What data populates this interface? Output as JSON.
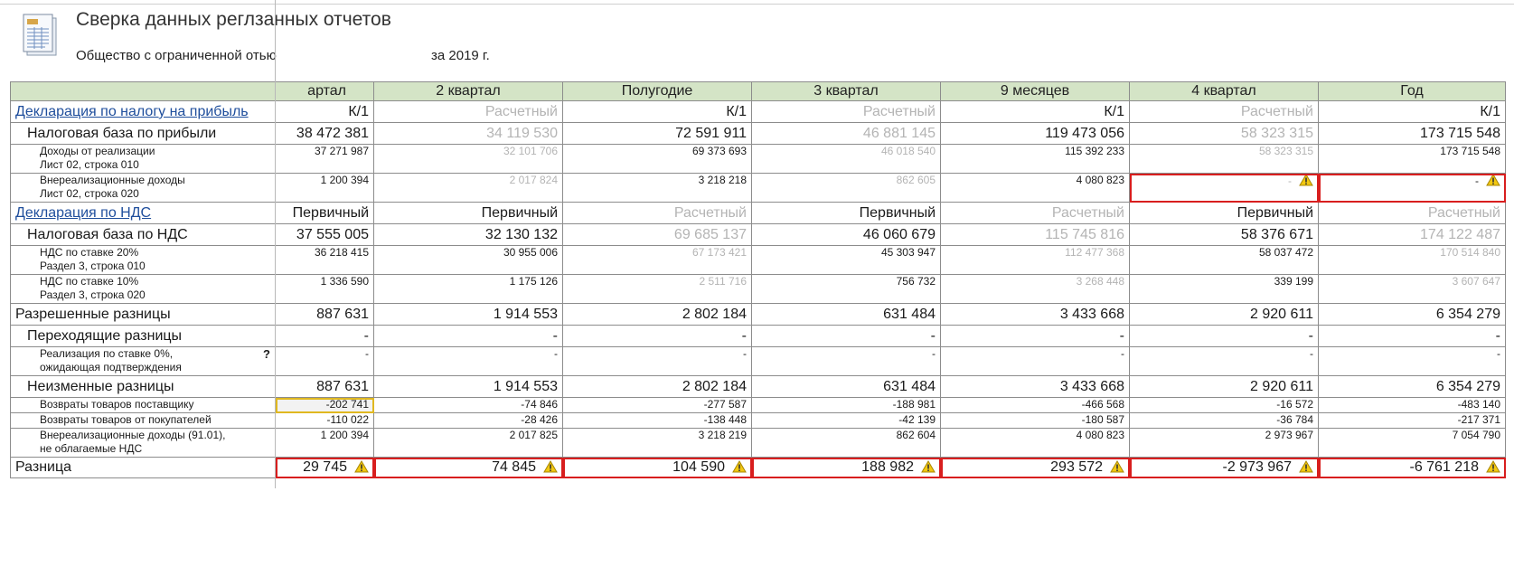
{
  "header": {
    "title": "Сверка данных реглзанных отчетов",
    "org": "Общество с ограниченной отью",
    "period": "за 2019 г."
  },
  "columns": [
    "артал",
    "2 квартал",
    "Полугодие",
    "3 квартал",
    "9 месяцев",
    "4 квартал",
    "Год"
  ],
  "sections": {
    "profit": {
      "label": "Декларация по налогу на прибыль",
      "statuses": [
        "К/1",
        "Расчетный",
        "К/1",
        "Расчетный",
        "К/1",
        "Расчетный",
        "К/1"
      ]
    },
    "vat": {
      "label": "Декларация по НДС",
      "statuses": [
        "Первичный",
        "Первичный",
        "Расчетный",
        "Первичный",
        "Расчетный",
        "Первичный",
        "Расчетный"
      ]
    }
  },
  "rows": {
    "profit_base": {
      "label": "Налоговая база по прибыли",
      "values": [
        "38 472 381",
        "34 119 530",
        "72 591 911",
        "46 881 145",
        "119 473 056",
        "58 323 315",
        "173 715 548"
      ]
    },
    "sales_income": {
      "label1": "Доходы от реализации",
      "label2": "Лист 02, строка 010",
      "values": [
        "37 271 987",
        "32 101 706",
        "69 373 693",
        "46 018 540",
        "115 392 233",
        "58 323 315",
        "173 715 548"
      ]
    },
    "nonop_income": {
      "label1": "Внереализационные доходы",
      "label2": "Лист 02, строка 020",
      "values": [
        "1 200 394",
        "2 017 824",
        "3 218 218",
        "862 605",
        "4 080 823",
        "-",
        "-"
      ]
    },
    "vat_base": {
      "label": "Налоговая база по НДС",
      "values": [
        "37 555 005",
        "32 130 132",
        "69 685 137",
        "46 060 679",
        "115 745 816",
        "58 376 671",
        "174 122 487"
      ]
    },
    "vat20": {
      "label1": "НДС по ставке 20%",
      "label2": "Раздел 3, строка 010",
      "values": [
        "36 218 415",
        "30 955 006",
        "67 173 421",
        "45 303 947",
        "112 477 368",
        "58 037 472",
        "170 514 840"
      ]
    },
    "vat10": {
      "label1": "НДС по ставке 10%",
      "label2": "Раздел 3, строка 020",
      "values": [
        "1 336 590",
        "1 175 126",
        "2 511 716",
        "756 732",
        "3 268 448",
        "339 199",
        "3 607 647"
      ]
    },
    "allowed": {
      "label": "Разрешенные разницы",
      "values": [
        "887 631",
        "1 914 553",
        "2 802 184",
        "631 484",
        "3 433 668",
        "2 920 611",
        "6 354 279"
      ]
    },
    "transit": {
      "label": "Переходящие разницы",
      "values": [
        "-",
        "-",
        "-",
        "-",
        "-",
        "-",
        "-"
      ]
    },
    "zero_rate": {
      "label1": "Реализация по ставке 0%,",
      "label2": "ожидающая подтверждения",
      "help": "?",
      "values": [
        "-",
        "-",
        "-",
        "-",
        "-",
        "-",
        "-"
      ]
    },
    "unchanged": {
      "label": "Неизменные разницы",
      "values": [
        "887 631",
        "1 914 553",
        "2 802 184",
        "631 484",
        "3 433 668",
        "2 920 611",
        "6 354 279"
      ]
    },
    "ret_supplier": {
      "label": "Возвраты товаров поставщику",
      "values": [
        "-202 741",
        "-74 846",
        "-277 587",
        "-188 981",
        "-466 568",
        "-16 572",
        "-483 140"
      ]
    },
    "ret_buyers": {
      "label": "Возвраты товаров от покупателей",
      "values": [
        "-110 022",
        "-28 426",
        "-138 448",
        "-42 139",
        "-180 587",
        "-36 784",
        "-217 371"
      ]
    },
    "nonop_novat": {
      "label1": "Внереализационные доходы (91.01),",
      "label2": "не облагаемые НДС",
      "values": [
        "1 200 394",
        "2 017 825",
        "3 218 219",
        "862 604",
        "4 080 823",
        "2 973 967",
        "7 054 790"
      ]
    },
    "diff": {
      "label": "Разница",
      "values": [
        "29 745",
        "74 845",
        "104 590",
        "188 982",
        "293 572",
        "-2 973 967",
        "-6 761 218"
      ]
    }
  },
  "colors": {
    "header_bg": "#d4e4c6",
    "error_border": "#d81e1e",
    "selection_border": "#e0b820",
    "muted_text": "#b4b4b4",
    "link": "#1f4e9c"
  },
  "icons": {
    "report": "document-icon",
    "warning": "warning-triangle-icon"
  }
}
